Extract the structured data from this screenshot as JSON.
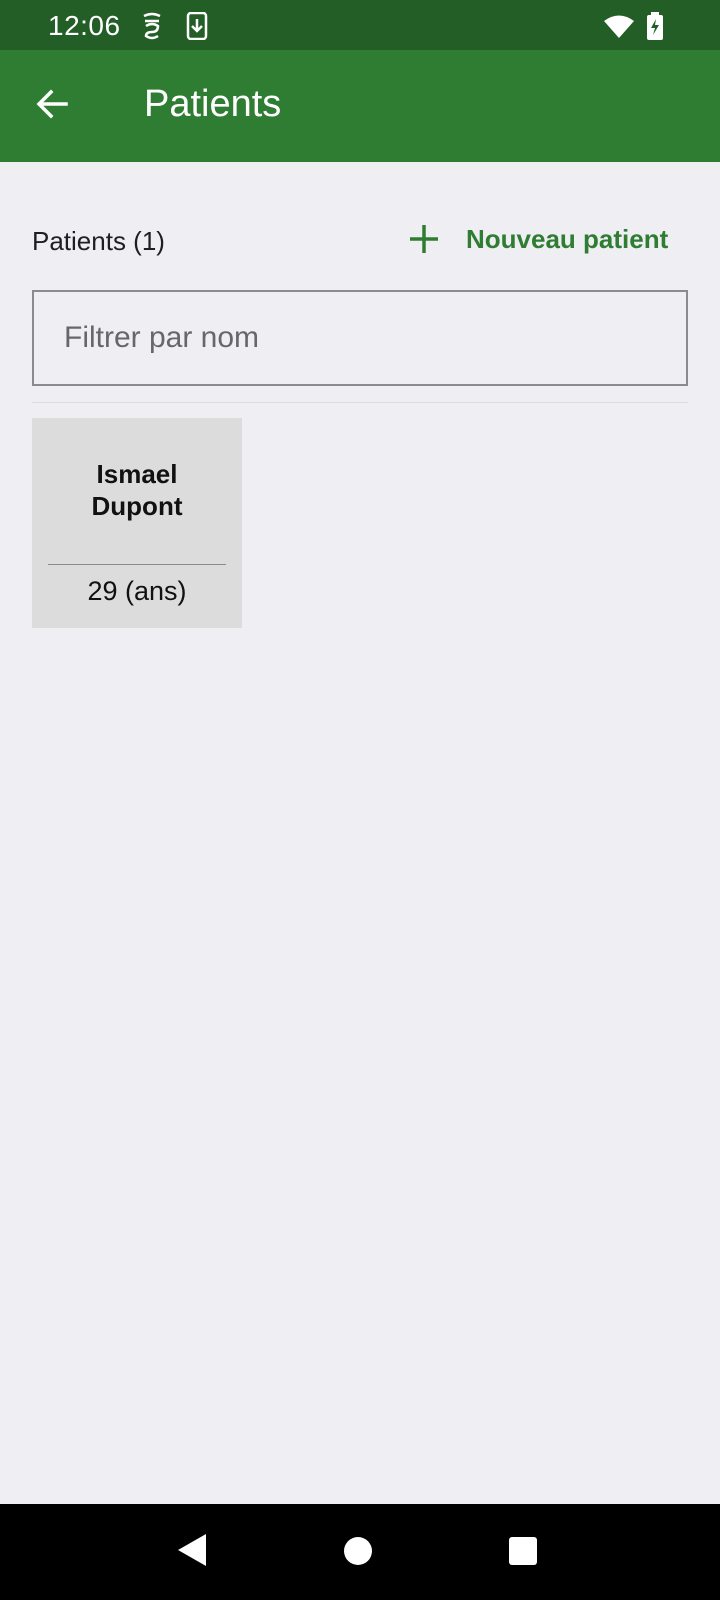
{
  "status_bar": {
    "time": "12:06",
    "icons": [
      "media-sync-icon",
      "download-icon",
      "wifi-icon",
      "battery-charging-icon"
    ]
  },
  "app_bar": {
    "title": "Patients",
    "back_icon": "arrow-back-icon",
    "color": "#2e7d32"
  },
  "list_header": {
    "count_label": "Patients (1)",
    "new_button_label": "Nouveau patient",
    "new_button_icon": "plus-icon"
  },
  "filter": {
    "placeholder": "Filtrer par nom",
    "value": ""
  },
  "patients": [
    {
      "first_name": "Ismael",
      "last_name": "Dupont",
      "age_label": "29 (ans)"
    }
  ],
  "nav_bar": {
    "icons": [
      "back-triangle-icon",
      "home-circle-icon",
      "recents-square-icon"
    ]
  },
  "colors": {
    "status_bar": "#225e25",
    "accent": "#2e7d32",
    "background": "#efeef3",
    "card": "#dcdcdc"
  }
}
